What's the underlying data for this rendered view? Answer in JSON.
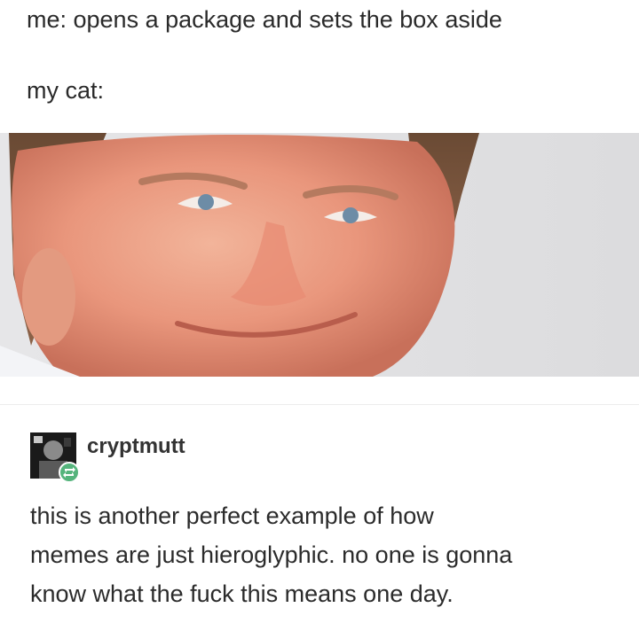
{
  "caption": {
    "line1": "me: opens a package and sets the box aside",
    "line2": "my cat:"
  },
  "reblog": {
    "username": "cryptmutt",
    "avatar_icon": "avatar-image",
    "badge_icon": "reblog-icon",
    "badge_color": "#55b47c"
  },
  "comment": {
    "lines": [
      "this is another perfect example of how",
      "memes are just hieroglyphic. no one is gonna",
      "know what the fuck this means one day."
    ]
  },
  "colors": {
    "text": "#2b2b2b",
    "background": "#ffffff",
    "photo_background": "#d8d8da"
  }
}
